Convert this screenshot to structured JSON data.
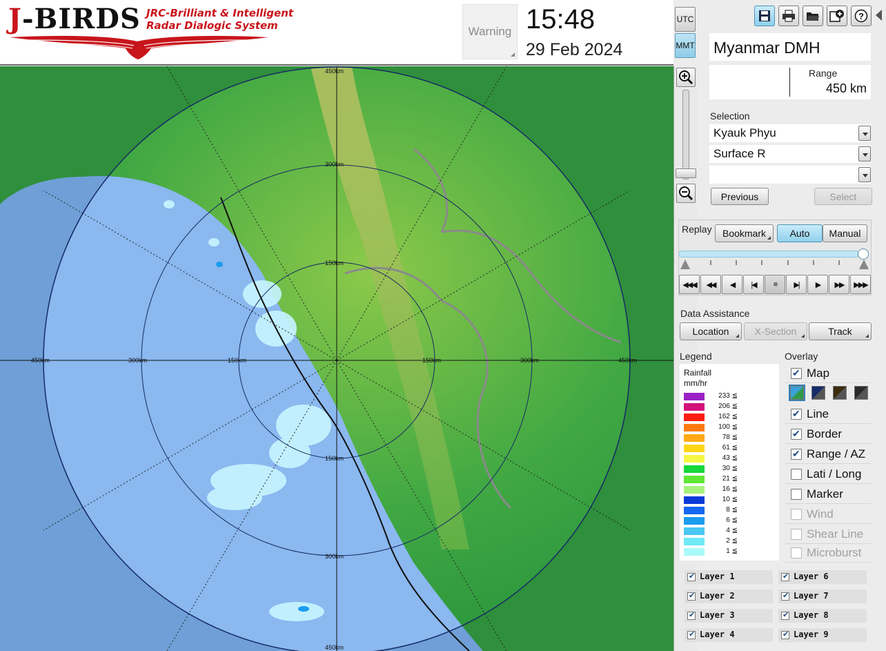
{
  "header": {
    "logo_title_j": "J",
    "logo_title_rest": "-BIRDS",
    "logo_sub1": "JRC-Brilliant & Intelligent",
    "logo_sub2": "Radar Dialogic System",
    "warning": "Warning",
    "time": "15:48",
    "date": "29 Feb 2024"
  },
  "timezones": {
    "utc": "UTC",
    "mmt": "MMT",
    "active": "MMT"
  },
  "toolbar": {
    "icons": [
      "save-icon",
      "print-icon",
      "folder-open-icon",
      "add-window-icon",
      "help-icon"
    ]
  },
  "site": {
    "name": "Myanmar DMH"
  },
  "range": {
    "label": "Range",
    "value": "450 km"
  },
  "selection": {
    "label": "Selection",
    "station": "Kyauk Phyu",
    "product": "Surface R",
    "extra": "",
    "previous": "Previous",
    "select": "Select"
  },
  "replay": {
    "label": "Replay",
    "bookmark": "Bookmark",
    "auto": "Auto",
    "manual": "Manual",
    "position": 1.0
  },
  "data_assistance": {
    "label": "Data Assistance",
    "location": "Location",
    "xsection": "X-Section",
    "track": "Track"
  },
  "legend": {
    "label": "Legend",
    "title": "Rainfall",
    "unit": "mm/hr",
    "entries": [
      {
        "value": "233 ≦",
        "color": "#9b1fc4"
      },
      {
        "value": "206 ≦",
        "color": "#d3117b"
      },
      {
        "value": "162 ≦",
        "color": "#ff1c12"
      },
      {
        "value": "100 ≦",
        "color": "#ff7a13"
      },
      {
        "value": "78 ≦",
        "color": "#ffaa14"
      },
      {
        "value": "61 ≦",
        "color": "#ffd616"
      },
      {
        "value": "43 ≦",
        "color": "#f6f744"
      },
      {
        "value": "30 ≦",
        "color": "#16d83a"
      },
      {
        "value": "21 ≦",
        "color": "#5ee835"
      },
      {
        "value": "16 ≦",
        "color": "#a7f27c"
      },
      {
        "value": "10 ≦",
        "color": "#0c3ad8"
      },
      {
        "value": "8 ≦",
        "color": "#1467f0"
      },
      {
        "value": "6 ≦",
        "color": "#1b9cf0"
      },
      {
        "value": "4 ≦",
        "color": "#49c7f3"
      },
      {
        "value": "2 ≦",
        "color": "#6feaf6"
      },
      {
        "value": "1 ≦",
        "color": "#a9faf8"
      }
    ]
  },
  "overlay": {
    "label": "Overlay",
    "items": [
      {
        "label": "Map",
        "checked": true,
        "enabled": true
      },
      {
        "label": "Line",
        "checked": true,
        "enabled": true
      },
      {
        "label": "Border",
        "checked": true,
        "enabled": true
      },
      {
        "label": "Range / AZ",
        "checked": true,
        "enabled": true
      },
      {
        "label": "Lati / Long",
        "checked": false,
        "enabled": true
      },
      {
        "label": "Marker",
        "checked": false,
        "enabled": true
      },
      {
        "label": "Wind",
        "checked": false,
        "enabled": false
      },
      {
        "label": "Shear Line",
        "checked": false,
        "enabled": false
      },
      {
        "label": "Microburst",
        "checked": false,
        "enabled": false
      }
    ],
    "map_styles": [
      "#3aa1d8",
      "#172b6a",
      "#3b2c10",
      "#2a2a2a"
    ]
  },
  "layers": [
    "Layer 1",
    "Layer 2",
    "Layer 3",
    "Layer 4",
    "Layer 6",
    "Layer 7",
    "Layer 8",
    "Layer 9"
  ],
  "map": {
    "range_labels": {
      "n450": "450km",
      "n300": "300km",
      "n150": "150km",
      "w450": "450km",
      "w300": "300km",
      "w150": "150km",
      "e150": "150km",
      "e300": "300km",
      "e450": "450km",
      "s150": "150km",
      "s300": "300km",
      "s450": "450km"
    }
  }
}
